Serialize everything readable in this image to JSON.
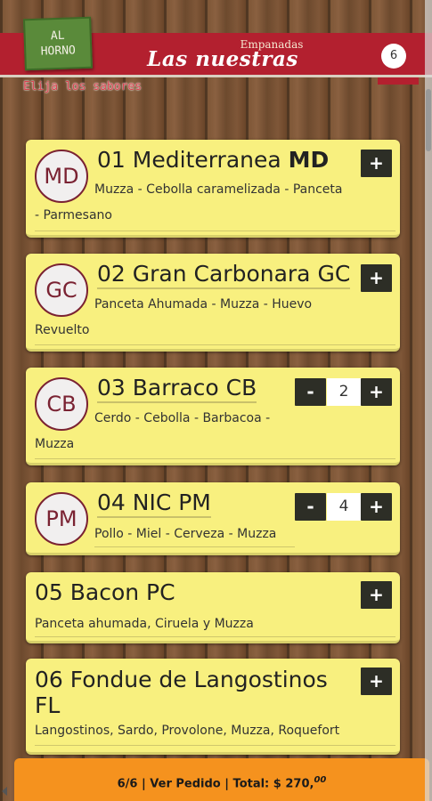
{
  "header": {
    "logo_line1": "AL",
    "logo_line2": "HORNO",
    "category": "Empanadas",
    "title": "Las nuestras",
    "cart_count": "6",
    "subtitle": "Elija los sabores"
  },
  "products": [
    {
      "badge": "MD",
      "number": "01",
      "name": "Mediterranea",
      "code": "MD",
      "desc_line1": "Muzza - Cebolla caramelizada - Panceta",
      "desc_line2": "- Parmesano",
      "qty": null
    },
    {
      "badge": "GC",
      "title": "02 Gran Carbonara GC",
      "desc_line1": "Panceta Ahumada - Muzza - Huevo",
      "desc_line2": "Revuelto",
      "qty": null
    },
    {
      "badge": "CB",
      "title": "03 Barraco CB",
      "desc_line1": "Cerdo - Cebolla - Barbacoa -",
      "desc_line2": "Muzza",
      "qty": "2"
    },
    {
      "badge": "PM",
      "title": "04 NIC PM",
      "desc_line1": "Pollo - Miel - Cerveza - Muzza",
      "qty": "4"
    },
    {
      "title": "05 Bacon PC",
      "desc_line1": "Panceta ahumada, Ciruela y Muzza",
      "qty": null
    },
    {
      "title_line1": "06 Fondue de Langostinos",
      "title_line2": "FL",
      "desc_line1": "Langostinos, Sardo, Provolone, Muzza, Roquefort",
      "qty": null
    }
  ],
  "controls": {
    "plus": "+",
    "minus": "-"
  },
  "footer": {
    "count": "6/6",
    "view_order": "Ver Pedido",
    "total_label": "Total: $ 270,",
    "total_cents": "00",
    "separator": "|"
  },
  "colors": {
    "banner": "#b3202f",
    "card": "#f8f07f",
    "button": "#2d2e26",
    "footer": "#f5921e",
    "badge_border": "#7a2232"
  }
}
